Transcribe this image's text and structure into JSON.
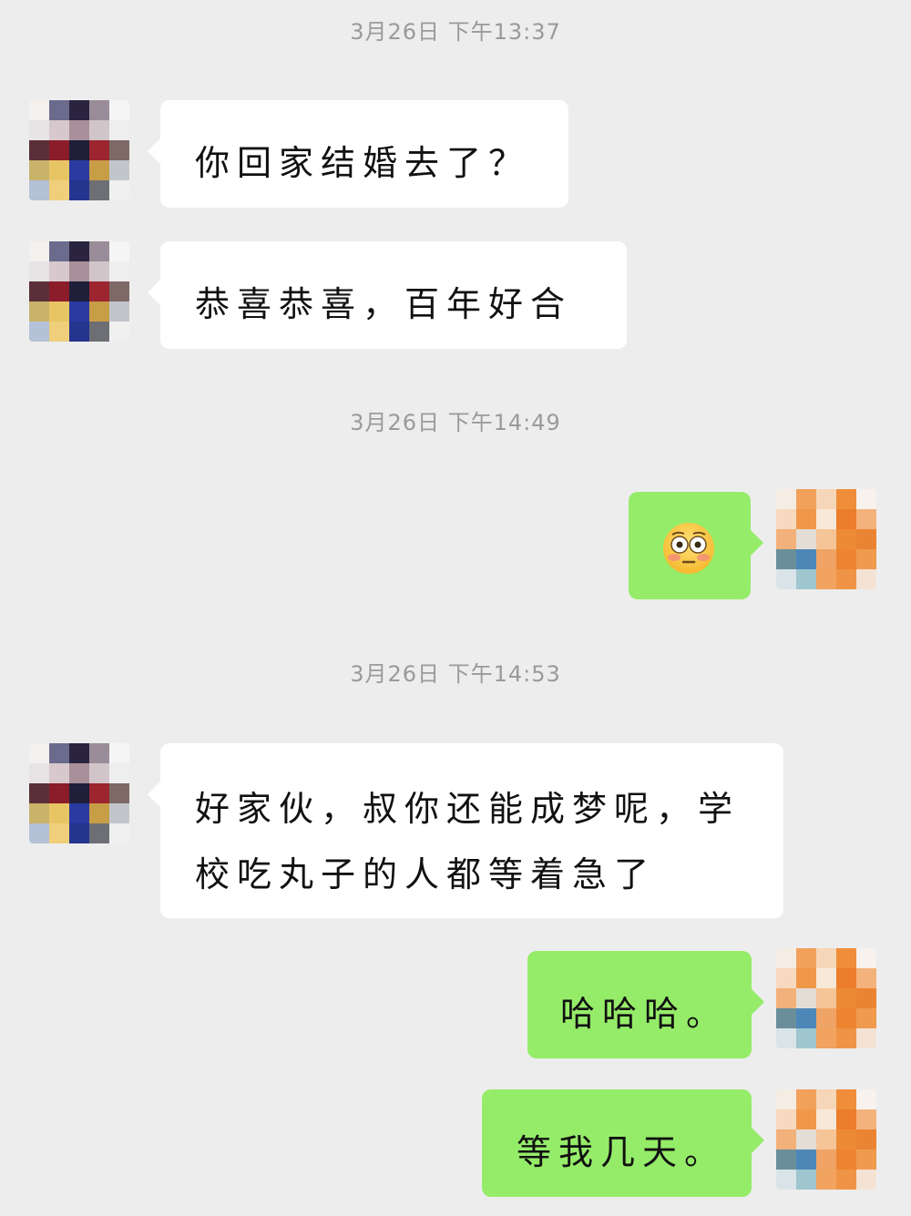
{
  "chat": {
    "messages": [
      {
        "kind": "timestamp",
        "text": "3月26日 下午13:37"
      },
      {
        "kind": "message",
        "side": "left",
        "avatar": "contact-avatar",
        "text": "你回家结婚去了？"
      },
      {
        "kind": "message",
        "side": "left",
        "avatar": "contact-avatar",
        "text": "恭喜恭喜，百年好合"
      },
      {
        "kind": "timestamp",
        "text": "3月26日 下午14:49"
      },
      {
        "kind": "message",
        "side": "right",
        "avatar": "self-avatar",
        "emoji": "flushed-face-emoji",
        "text": ""
      },
      {
        "kind": "timestamp",
        "text": "3月26日 下午14:53"
      },
      {
        "kind": "message",
        "side": "left",
        "avatar": "contact-avatar",
        "text": "好家伙，叔你还能成梦呢，学校吃丸子的人都等着急了"
      },
      {
        "kind": "message",
        "side": "right",
        "avatar": "self-avatar",
        "text": "哈哈哈。"
      },
      {
        "kind": "message",
        "side": "right",
        "avatar": "self-avatar",
        "text": "等我几天。"
      }
    ]
  },
  "colors": {
    "background": "#ededed",
    "bubble_self": "#95ec69",
    "bubble_contact": "#ffffff",
    "timestamp_text": "#9a9a9a"
  },
  "icons": {
    "contact_avatar": "pixelated-avatar",
    "self_avatar": "pixelated-avatar",
    "emoji": "flushed-face-emoji"
  }
}
